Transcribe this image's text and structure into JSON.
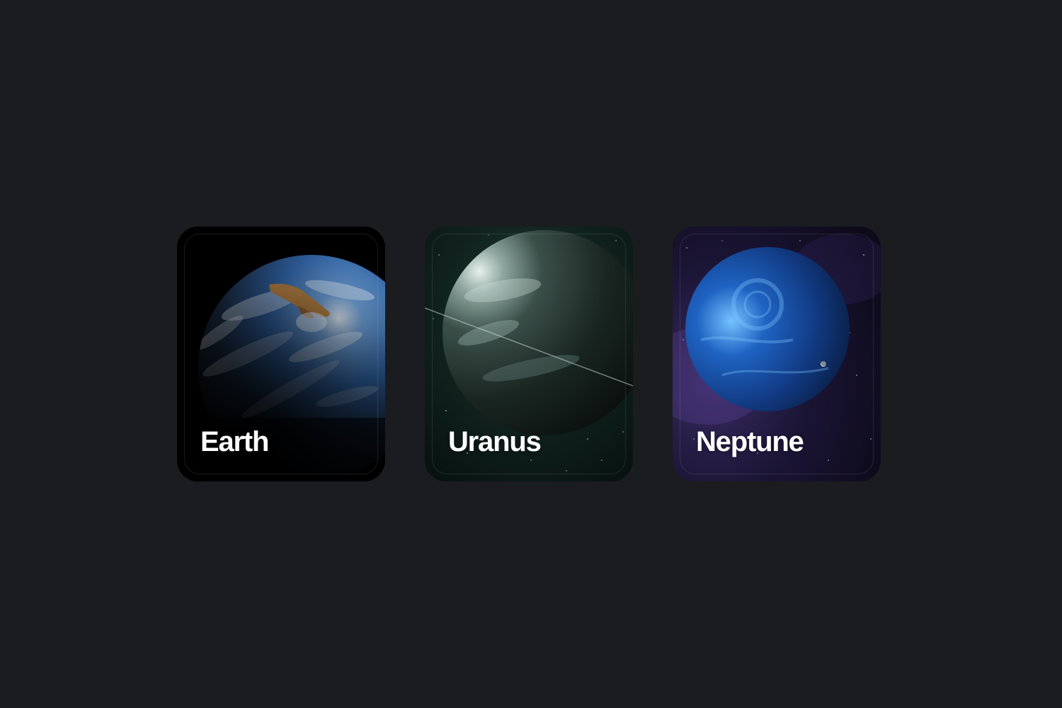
{
  "cards": [
    {
      "title": "Earth",
      "icon": "earth-image"
    },
    {
      "title": "Uranus",
      "icon": "uranus-image"
    },
    {
      "title": "Neptune",
      "icon": "neptune-image"
    }
  ],
  "colors": {
    "background": "#1b1c20",
    "text": "#ffffff",
    "earth_ocean": "#2a5d9a",
    "earth_land": "#b27a3a",
    "uranus_surface": "#3b4f49",
    "neptune_surface": "#1f63c2"
  }
}
